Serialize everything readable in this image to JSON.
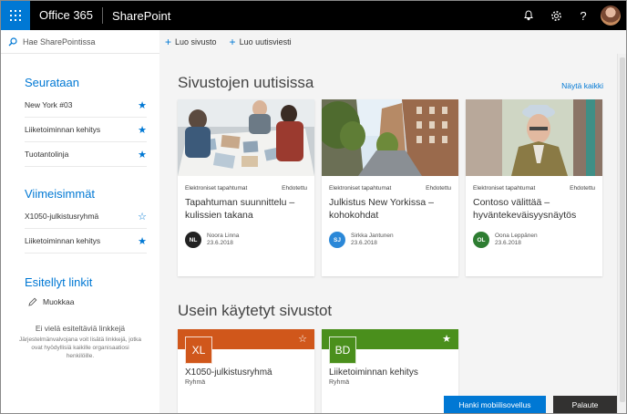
{
  "suitebar": {
    "brand": "Office 365",
    "app": "SharePoint",
    "icons": [
      "waffle-icon",
      "bell-icon",
      "gear-icon",
      "help-icon"
    ],
    "help_glyph": "?"
  },
  "leftnav": {
    "search_placeholder": "Hae SharePointissa",
    "following_heading": "Seurataan",
    "following": [
      {
        "label": "New York #03"
      },
      {
        "label": "Liiketoiminnan kehitys"
      },
      {
        "label": "Tuotantolinja"
      }
    ],
    "recent_heading": "Viimeisimmät",
    "recent": [
      {
        "label": "X1050-julkistusryhmä",
        "starred": false
      },
      {
        "label": "Liiketoiminnan kehitys",
        "starred": true
      }
    ],
    "featured_heading": "Esitellyt linkit",
    "edit_label": "Muokkaa",
    "empty_title": "Ei vielä esiteltäviä linkkejä",
    "empty_desc": "Järjestelmänvalvojana voit lisätä linkkejä, jotka ovat hyödyllisiä kaikille organisaatiosi henkilöille."
  },
  "commandbar": {
    "create_site": "Luo sivusto",
    "create_news": "Luo uutisviesti"
  },
  "news": {
    "title": "Sivustojen uutisissa",
    "see_all": "Näytä kaikki",
    "cards": [
      {
        "category": "Elektroniset tapahtumat",
        "tag": "Ehdotettu",
        "title": "Tapahtuman suunnittelu – kulissien takana",
        "initials": "NL",
        "author": "Noora Linna",
        "date": "23.6.2018",
        "badge_color": "#222222"
      },
      {
        "category": "Elektroniset tapahtumat",
        "tag": "Ehdotettu",
        "title": "Julkistus New Yorkissa – kohokohdat",
        "initials": "SJ",
        "author": "Sirkka Jantunen",
        "date": "23.6.2018",
        "badge_color": "#2b88d8"
      },
      {
        "category": "Elektroniset tapahtumat",
        "tag": "Ehdotettu",
        "title": "Contoso välittää – hyväntekeväisyysnäytös",
        "initials": "OL",
        "author": "Oona Leppänen",
        "date": "23.6.2018",
        "badge_color": "#2e7d32"
      }
    ]
  },
  "frequent": {
    "title": "Usein käytetyt sivustot",
    "sites": [
      {
        "logo": "XL",
        "name": "X1050-julkistusryhmä",
        "type": "Ryhmä",
        "color": "#d0571b",
        "starred": false
      },
      {
        "logo": "BD",
        "name": "Liiketoiminnan kehitys",
        "type": "Ryhmä",
        "color": "#4a8f1c",
        "starred": true
      }
    ]
  },
  "footer": {
    "mobile_app": "Hanki mobiilisovellus",
    "feedback": "Palaute"
  },
  "colors": {
    "accent": "#0078d4",
    "suitebar": "#000000"
  }
}
